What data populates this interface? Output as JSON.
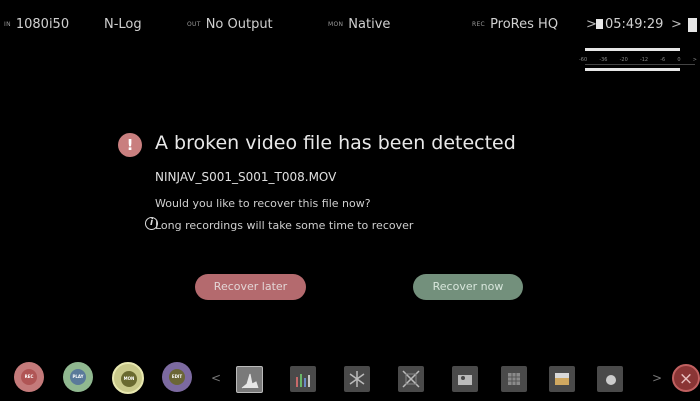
{
  "topbar": {
    "resolution": "1080i50",
    "log_mode": "N-Log",
    "out_tag": "OUT",
    "output": "No Output",
    "mon_tag": "MON",
    "monitor": "Native",
    "rec_tag": "REC",
    "codec": "ProRes HQ",
    "arrow": ">",
    "remaining_time": "05:49:29",
    "arrow2": ">"
  },
  "meter": {
    "scale": [
      "-60",
      "-36",
      "-20",
      "-12",
      "-6",
      "0",
      ">"
    ],
    "levels": [
      0.86,
      0.86
    ]
  },
  "dialog": {
    "warning_symbol": "!",
    "title": "A broken video file has been detected",
    "filename": "NINJAV_S001_S001_T008.MOV",
    "question": "Would you like to recover this file now?",
    "info_symbol": "i",
    "info": "Long recordings will take some time to recover",
    "recover_later": "Recover later",
    "recover_now": "Recover now"
  },
  "bottombar": {
    "rec": "REC",
    "play": "PLAY",
    "mon": "MON",
    "edit": "EDIT",
    "left_arrow": "<",
    "right_arrow": ">",
    "close": "×"
  },
  "icons": [
    "waveform-icon",
    "histogram-icon",
    "false-color-icon",
    "cross-icon",
    "zebra-icon",
    "focus-peaking-icon",
    "frame-guides-icon",
    "lut-icon"
  ],
  "colors": {
    "warning": "#c97f7f",
    "recover_later_bg": "#b46a6e",
    "recover_now_bg": "#73907c",
    "close": "#8a3535"
  }
}
